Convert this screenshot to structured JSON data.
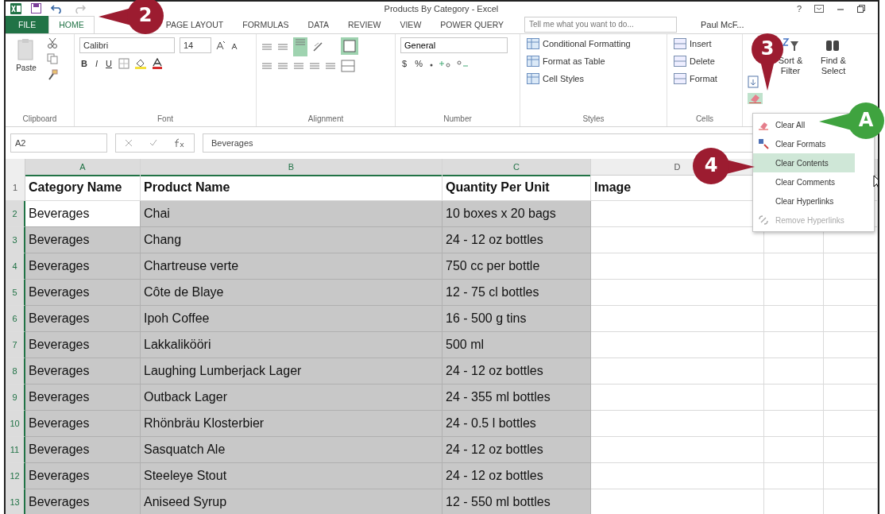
{
  "window": {
    "title": "Products By Category - Excel",
    "help": "?"
  },
  "tabs": [
    {
      "label": "FILE",
      "kind": "file",
      "selected": false
    },
    {
      "label": "HOME",
      "kind": "tab",
      "selected": true
    },
    {
      "label": "PAGE LAYOUT",
      "kind": "tab",
      "selected": false
    },
    {
      "label": "FORMULAS",
      "kind": "tab",
      "selected": false
    },
    {
      "label": "DATA",
      "kind": "tab",
      "selected": false
    },
    {
      "label": "REVIEW",
      "kind": "tab",
      "selected": false
    },
    {
      "label": "VIEW",
      "kind": "tab",
      "selected": false
    },
    {
      "label": "POWER QUERY",
      "kind": "tab",
      "selected": false
    }
  ],
  "search": {
    "placeholder": "Tell me what you want to do..."
  },
  "user": "Paul McF...",
  "ribbon": {
    "clipboard": {
      "paste": "Paste",
      "label": "Clipboard"
    },
    "font": {
      "name": "Calibri",
      "points": "14",
      "bold": "B",
      "italic": "I",
      "underline": "U",
      "label": "Font"
    },
    "alignment": {
      "label": "Alignment"
    },
    "number": {
      "format": "General",
      "currency": "$",
      "percent": "%",
      "label": "Number"
    },
    "styles": {
      "items": [
        "Conditional Formatting",
        "Format as Table",
        "Cell Styles"
      ],
      "label": "Styles"
    },
    "cells": {
      "items": [
        "Insert",
        "Delete",
        "Format"
      ],
      "label": "Cells"
    },
    "editing": {
      "clear_pressed": true,
      "items": [
        "Sort & Filter",
        "Find & Select"
      ]
    }
  },
  "formula_bar": {
    "name_box": "A2",
    "value": "Beverages"
  },
  "columns": [
    {
      "label": "A",
      "selected": true
    },
    {
      "label": "B",
      "selected": true
    },
    {
      "label": "C",
      "selected": true
    },
    {
      "label": "D",
      "selected": false
    }
  ],
  "rows": [
    {
      "number": "1",
      "kind": "header",
      "selected": false,
      "active": false,
      "cells": [
        "Category Name",
        "Product Name",
        "Quantity Per Unit",
        "Image"
      ]
    },
    {
      "number": "2",
      "kind": "data",
      "selected": true,
      "active": true,
      "cells": [
        "Beverages",
        "Chai",
        "10 boxes x 20 bags"
      ]
    },
    {
      "number": "3",
      "kind": "data",
      "selected": true,
      "active": false,
      "cells": [
        "Beverages",
        "Chang",
        "24 - 12 oz bottles"
      ]
    },
    {
      "number": "4",
      "kind": "data",
      "selected": true,
      "active": false,
      "cells": [
        "Beverages",
        "Chartreuse verte",
        "750 cc per bottle"
      ]
    },
    {
      "number": "5",
      "kind": "data",
      "selected": true,
      "active": false,
      "cells": [
        "Beverages",
        "Côte de Blaye",
        "12 - 75 cl bottles"
      ]
    },
    {
      "number": "6",
      "kind": "data",
      "selected": true,
      "active": false,
      "cells": [
        "Beverages",
        "Ipoh Coffee",
        "16 - 500 g tins"
      ]
    },
    {
      "number": "7",
      "kind": "data",
      "selected": true,
      "active": false,
      "cells": [
        "Beverages",
        "Lakkalikööri",
        "500 ml"
      ]
    },
    {
      "number": "8",
      "kind": "data",
      "selected": true,
      "active": false,
      "cells": [
        "Beverages",
        "Laughing Lumberjack Lager",
        "24 - 12 oz bottles"
      ]
    },
    {
      "number": "9",
      "kind": "data",
      "selected": true,
      "active": false,
      "cells": [
        "Beverages",
        "Outback Lager",
        "24 - 355 ml bottles"
      ]
    },
    {
      "number": "10",
      "kind": "data",
      "selected": true,
      "active": false,
      "cells": [
        "Beverages",
        "Rhönbräu Klosterbier",
        "24 - 0.5 l bottles"
      ]
    },
    {
      "number": "11",
      "kind": "data",
      "selected": true,
      "active": false,
      "cells": [
        "Beverages",
        "Sasquatch Ale",
        "24 - 12 oz bottles"
      ]
    },
    {
      "number": "12",
      "kind": "data",
      "selected": true,
      "active": false,
      "cells": [
        "Beverages",
        "Steeleye Stout",
        "24 - 12 oz bottles"
      ]
    },
    {
      "number": "13",
      "kind": "data",
      "selected": true,
      "active": false,
      "cells": [
        "Beverages",
        "Aniseed Syrup",
        "12 - 550 ml bottles"
      ]
    }
  ],
  "menu": [
    {
      "label": "Clear All",
      "kind": "eraser",
      "selected": false,
      "disabled": false
    },
    {
      "label": "Clear Formats",
      "kind": "formats",
      "selected": false,
      "disabled": false
    },
    {
      "label": "Clear Contents",
      "kind": "plain",
      "selected": true,
      "disabled": false
    },
    {
      "label": "Clear Comments",
      "kind": "plain",
      "selected": false,
      "disabled": false
    },
    {
      "label": "Clear Hyperlinks",
      "kind": "plain",
      "selected": false,
      "disabled": false
    },
    {
      "label": "Remove Hyperlinks",
      "kind": "unlink",
      "selected": false,
      "disabled": true
    }
  ],
  "callouts": [
    {
      "label": "2",
      "kind": "left",
      "color": "#9c1c30"
    },
    {
      "label": "3",
      "kind": "down",
      "color": "#9c1c30"
    },
    {
      "label": "4",
      "kind": "right",
      "color": "#9c1c30"
    },
    {
      "label": "A",
      "kind": "left",
      "color": "#3fa33f"
    }
  ]
}
